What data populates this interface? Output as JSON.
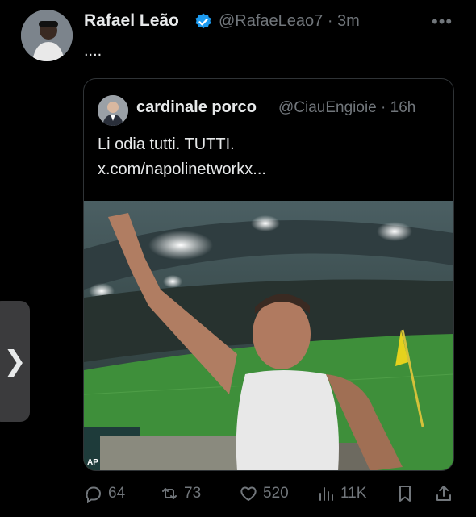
{
  "post": {
    "author_name": "Rafael Leão",
    "handle_time": "@RafaeLeao7 · 3m",
    "text": "....",
    "more_icon": "more-dots-icon"
  },
  "quoted": {
    "author_name": "cardinale porco",
    "handle_time": "@CiauEngioie · 16h",
    "line1": "Li odia tutti. TUTTI.",
    "line2": "x.com/napolinetworkx...",
    "image_credit": "AP"
  },
  "actions": {
    "replies": "64",
    "reposts": "73",
    "likes": "520",
    "views": "11K"
  },
  "side_tab": {
    "glyph": "❯"
  },
  "colors": {
    "background": "#000000",
    "text": "#e7e9ea",
    "muted": "#71767b",
    "verified": "#1d9bf0",
    "border": "#2f3336"
  }
}
